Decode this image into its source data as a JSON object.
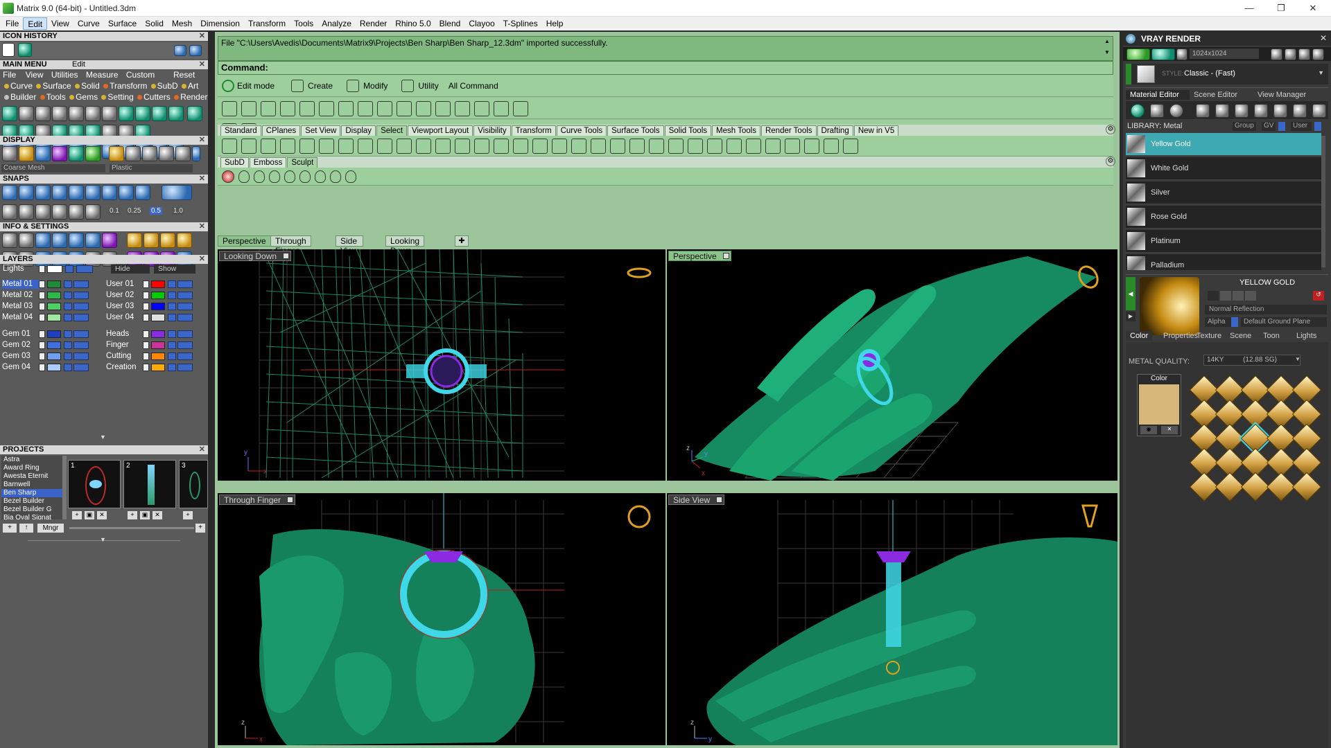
{
  "window": {
    "title": "Matrix 9.0 (64-bit) - Untitled.3dm",
    "minimize": "—",
    "maximize": "❐",
    "close": "✕"
  },
  "menubar": [
    "File",
    "Edit",
    "View",
    "Curve",
    "Surface",
    "Solid",
    "Mesh",
    "Dimension",
    "Transform",
    "Tools",
    "Analyze",
    "Render",
    "Rhino 5.0",
    "Blend",
    "Clayoo",
    "T-Splines",
    "Help"
  ],
  "left": {
    "icon_history": "ICON HISTORY",
    "main_menu": "MAIN MENU",
    "main_menu_edit": "Edit",
    "menu_row1": [
      "File",
      "View",
      "Utilities",
      "Measure",
      "Custom"
    ],
    "reset": "Reset",
    "menu_row2": [
      "Curve",
      "Surface",
      "Solid",
      "Transform",
      "SubD",
      "Art"
    ],
    "menu_row3": [
      "Builder",
      "Tools",
      "Gems",
      "Setting",
      "Cutters",
      "Render"
    ],
    "display": "DISPLAY",
    "display_mesh": "Coarse Mesh",
    "display_material": "Plastic",
    "snaps": "SNAPS",
    "snap_values": [
      "0.1",
      "0.25",
      "0.5",
      "1.0"
    ],
    "info_settings": "INFO & SETTINGS",
    "layers": "LAYERS",
    "lights": "Lights",
    "hide": "Hide",
    "show": "Show",
    "layer_left": [
      {
        "name": "Metal 01",
        "color": "#1f8a3a"
      },
      {
        "name": "Metal 02",
        "color": "#2fb84a"
      },
      {
        "name": "Metal 03",
        "color": "#4fd064"
      },
      {
        "name": "Metal 04",
        "color": "#9fe7a0"
      },
      {
        "name": "Gem 01",
        "color": "#1f3fc0"
      },
      {
        "name": "Gem 02",
        "color": "#3f6fe0"
      },
      {
        "name": "Gem 03",
        "color": "#6f9ff0"
      },
      {
        "name": "Gem 04",
        "color": "#aaccff"
      }
    ],
    "layer_right": [
      {
        "name": "User 01",
        "color": "#ff0000"
      },
      {
        "name": "User 02",
        "color": "#00cc00"
      },
      {
        "name": "User 03",
        "color": "#0000ff"
      },
      {
        "name": "User 04",
        "color": "#e0e0e0"
      },
      {
        "name": "Heads",
        "color": "#8a2be2"
      },
      {
        "name": "Finger",
        "color": "#cc3399"
      },
      {
        "name": "Cutting",
        "color": "#ff8800"
      },
      {
        "name": "Creation",
        "color": "#ffaa00"
      }
    ],
    "projects": "PROJECTS",
    "project_list": [
      "Astra",
      "Award Ring",
      "Awesta Eternit",
      "Barnwell",
      "Ben Sharp",
      "Bezel Builder",
      "Bezel Builder G",
      "Bia Oval Signat"
    ],
    "project_selected": 4,
    "thumbs": [
      "1",
      "2",
      "3"
    ],
    "mngr": "Mngr"
  },
  "main": {
    "message": "File \"C:\\Users\\Avedis\\Documents\\Matrix9\\Projects\\Ben Sharp\\Ben Sharp_12.3dm\" imported successfully.",
    "command_label": "Command:",
    "mode_buttons": [
      "Edit mode",
      "Create",
      "Modify",
      "Utility",
      "All Command"
    ],
    "tabs": [
      "Standard",
      "CPlanes",
      "Set View",
      "Display",
      "Select",
      "Viewport Layout",
      "Visibility",
      "Transform",
      "Curve Tools",
      "Surface Tools",
      "Solid Tools",
      "Mesh Tools",
      "Render Tools",
      "Drafting",
      "New in V5"
    ],
    "active_tab": "Select",
    "subtabs": [
      "SubD",
      "Emboss",
      "Sculpt"
    ],
    "active_subtab": "Sculpt",
    "view_tabs": [
      "Perspective",
      "Through Finger",
      "Side View",
      "Looking Down"
    ],
    "active_view_tab": "Perspective",
    "viewports": {
      "tl": "Looking Down",
      "tr": "Perspective",
      "bl": "Through Finger",
      "br": "Side View"
    },
    "axis_x": "x",
    "axis_y": "y",
    "axis_z": "z"
  },
  "right": {
    "title": "VRAY RENDER",
    "resolution": "1024x1024",
    "style_label": "STYLE:",
    "style_value": "Classic - (Fast)",
    "tabs": [
      "Material Editor",
      "Scene Editor",
      "View Manager"
    ],
    "library": "LIBRARY: Metal",
    "group": "Group",
    "gv": "GV",
    "user": "User",
    "materials": [
      "Yellow Gold",
      "White Gold",
      "Silver",
      "Rose Gold",
      "Platinum",
      "Palladium"
    ],
    "selected_material": 0,
    "preview_name": "YELLOW GOLD",
    "reflection": "Normal Reflection",
    "alpha": "Alpha",
    "ground": "Default Ground Plane",
    "sub_tabs": [
      "Color",
      "Properties",
      "Texture",
      "Scene",
      "Toon",
      "Lights"
    ],
    "metal_quality_label": "METAL QUALITY:",
    "metal_quality_value": "14KY          (12.88 SG)",
    "color_label": "Color",
    "swatch_color": "#d8b77a"
  }
}
